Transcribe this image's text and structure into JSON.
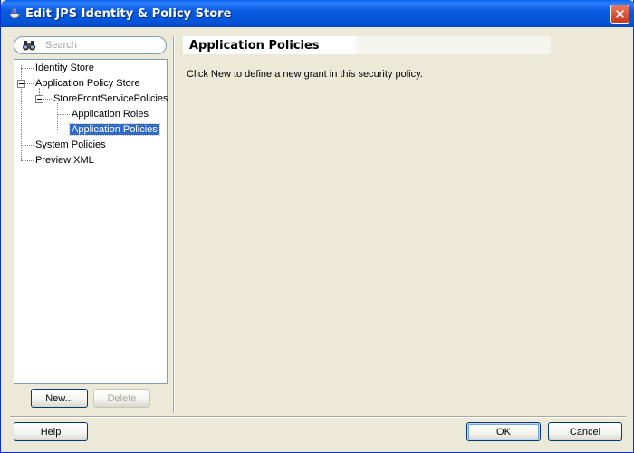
{
  "window": {
    "title": "Edit JPS Identity & Policy Store",
    "close_glyph": "✕",
    "icon": "app-icon"
  },
  "search": {
    "placeholder": "Search",
    "icon": "binoculars-icon"
  },
  "tree": {
    "items": [
      {
        "label": "Identity Store"
      },
      {
        "label": "Application Policy Store"
      },
      {
        "label": "StoreFrontServicePolicies"
      },
      {
        "label": "Application Roles"
      },
      {
        "label": "Application Policies",
        "selected": true
      },
      {
        "label": "System Policies"
      },
      {
        "label": "Preview XML"
      }
    ]
  },
  "left_buttons": {
    "new_label": "New...",
    "delete_label": "Delete"
  },
  "content": {
    "title": "Application Policies",
    "message": "Click New to define a new grant in this security policy."
  },
  "footer": {
    "help_label": "Help",
    "ok_label": "OK",
    "cancel_label": "Cancel"
  },
  "colors": {
    "titlebar": "#0a5ae0",
    "selection": "#316ac5",
    "dialog_bg": "#ece9d8"
  }
}
